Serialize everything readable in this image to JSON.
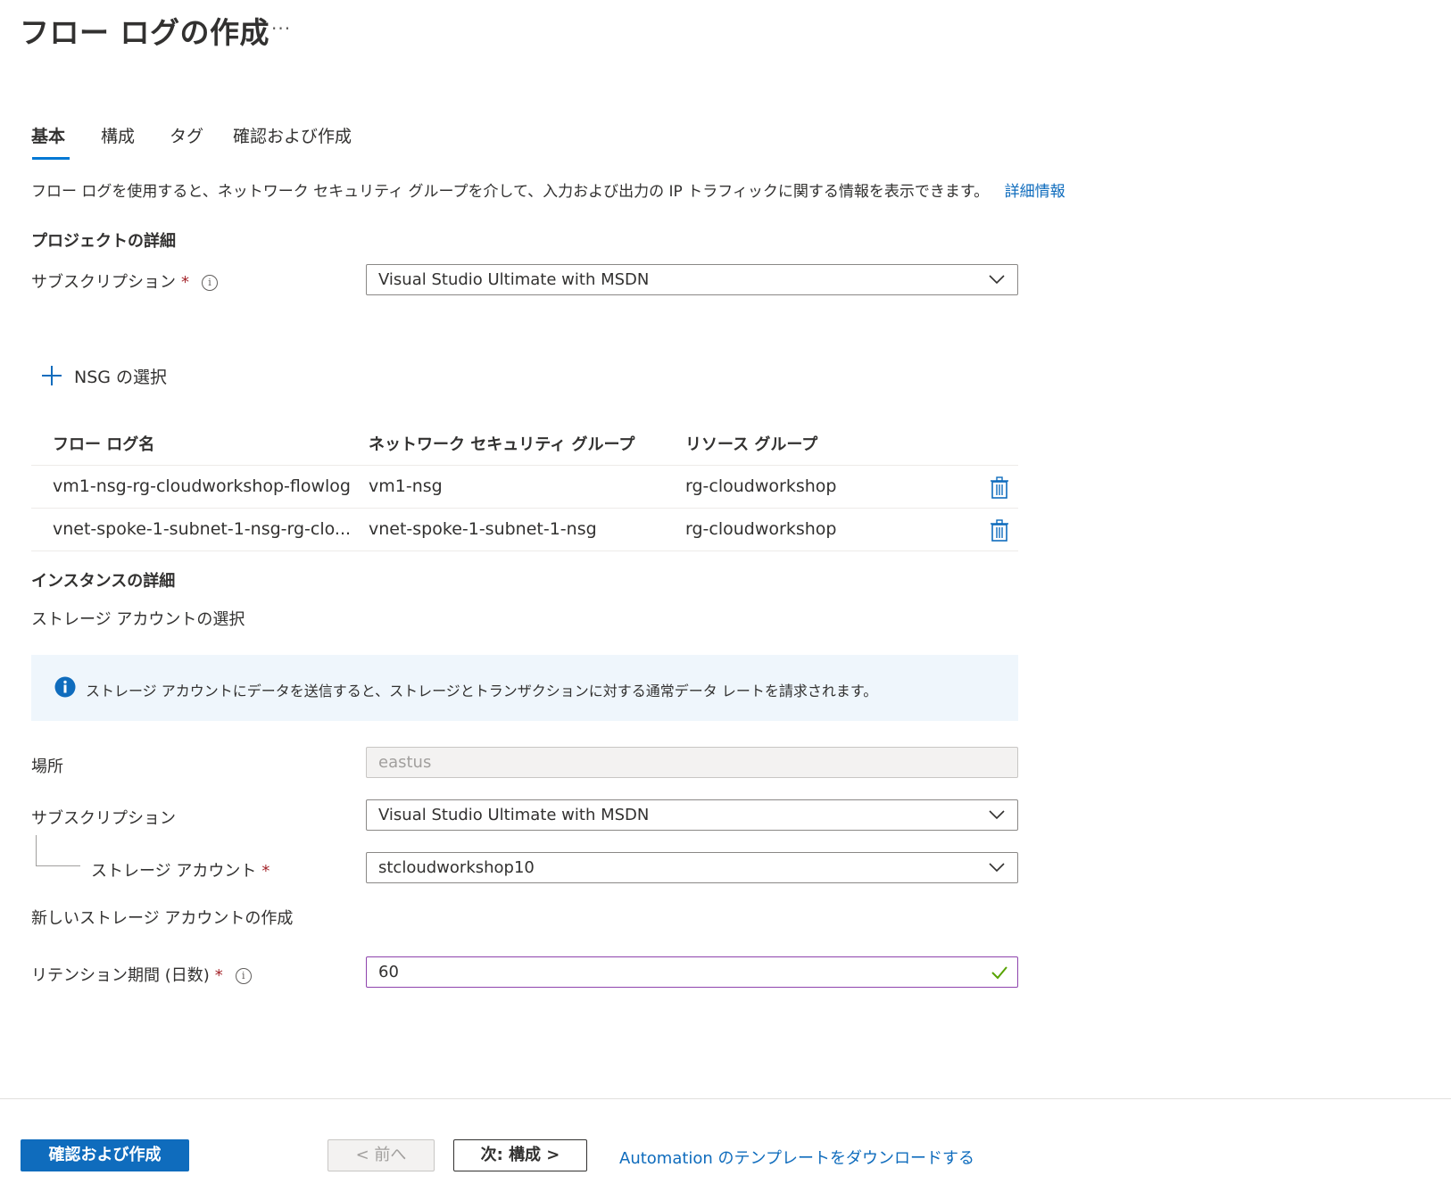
{
  "page": {
    "title": "フロー ログの作成",
    "more": "···"
  },
  "tabs": [
    {
      "label": "基本"
    },
    {
      "label": "構成"
    },
    {
      "label": "タグ"
    },
    {
      "label": "確認および作成"
    }
  ],
  "description": {
    "text": "フロー ログを使用すると、ネットワーク セキュリティ グループを介して、入力および出力の IP トラフィックに関する情報を表示できます。",
    "link": "詳細情報"
  },
  "project": {
    "heading": "プロジェクトの詳細",
    "subscription_label": "サブスクリプション",
    "subscription_value": "Visual Studio Ultimate with MSDN"
  },
  "nsg": {
    "select_label": "NSG の選択",
    "columns": [
      "フロー ログ名",
      "ネットワーク セキュリティ グループ",
      "リソース グループ"
    ],
    "rows": [
      {
        "flow_log": "vm1-nsg-rg-cloudworkshop-flowlog",
        "nsg": "vm1-nsg",
        "rg": "rg-cloudworkshop"
      },
      {
        "flow_log": "vnet-spoke-1-subnet-1-nsg-rg-clo...",
        "nsg": "vnet-spoke-1-subnet-1-nsg",
        "rg": "rg-cloudworkshop"
      }
    ]
  },
  "instance": {
    "heading": "インスタンスの詳細",
    "storage_select": "ストレージ アカウントの選択",
    "banner": "ストレージ アカウントにデータを送信すると、ストレージとトランザクションに対する通常データ レートを請求されます。",
    "location_label": "場所",
    "location_value": "eastus",
    "subscription_label": "サブスクリプション",
    "subscription_value": "Visual Studio Ultimate with MSDN",
    "storage_label": "ストレージ アカウント",
    "storage_value": "stcloudworkshop10",
    "create_storage_link": "新しいストレージ アカウントの作成",
    "retention_label": "リテンション期間 (日数)",
    "retention_value": "60"
  },
  "required_mark": "*",
  "info_glyph": "i",
  "footer": {
    "review_create": "確認および作成",
    "prev": "< 前へ",
    "next": "次: 構成 >",
    "download_link": "Automation のテンプレートをダウンロードする"
  },
  "colors": {
    "accent": "#0078d4",
    "link": "#0f6cbd",
    "required": "#a4262c",
    "banner_bg": "#eff6fc",
    "active_border": "#8e44ad",
    "valid_check": "#57a300"
  }
}
